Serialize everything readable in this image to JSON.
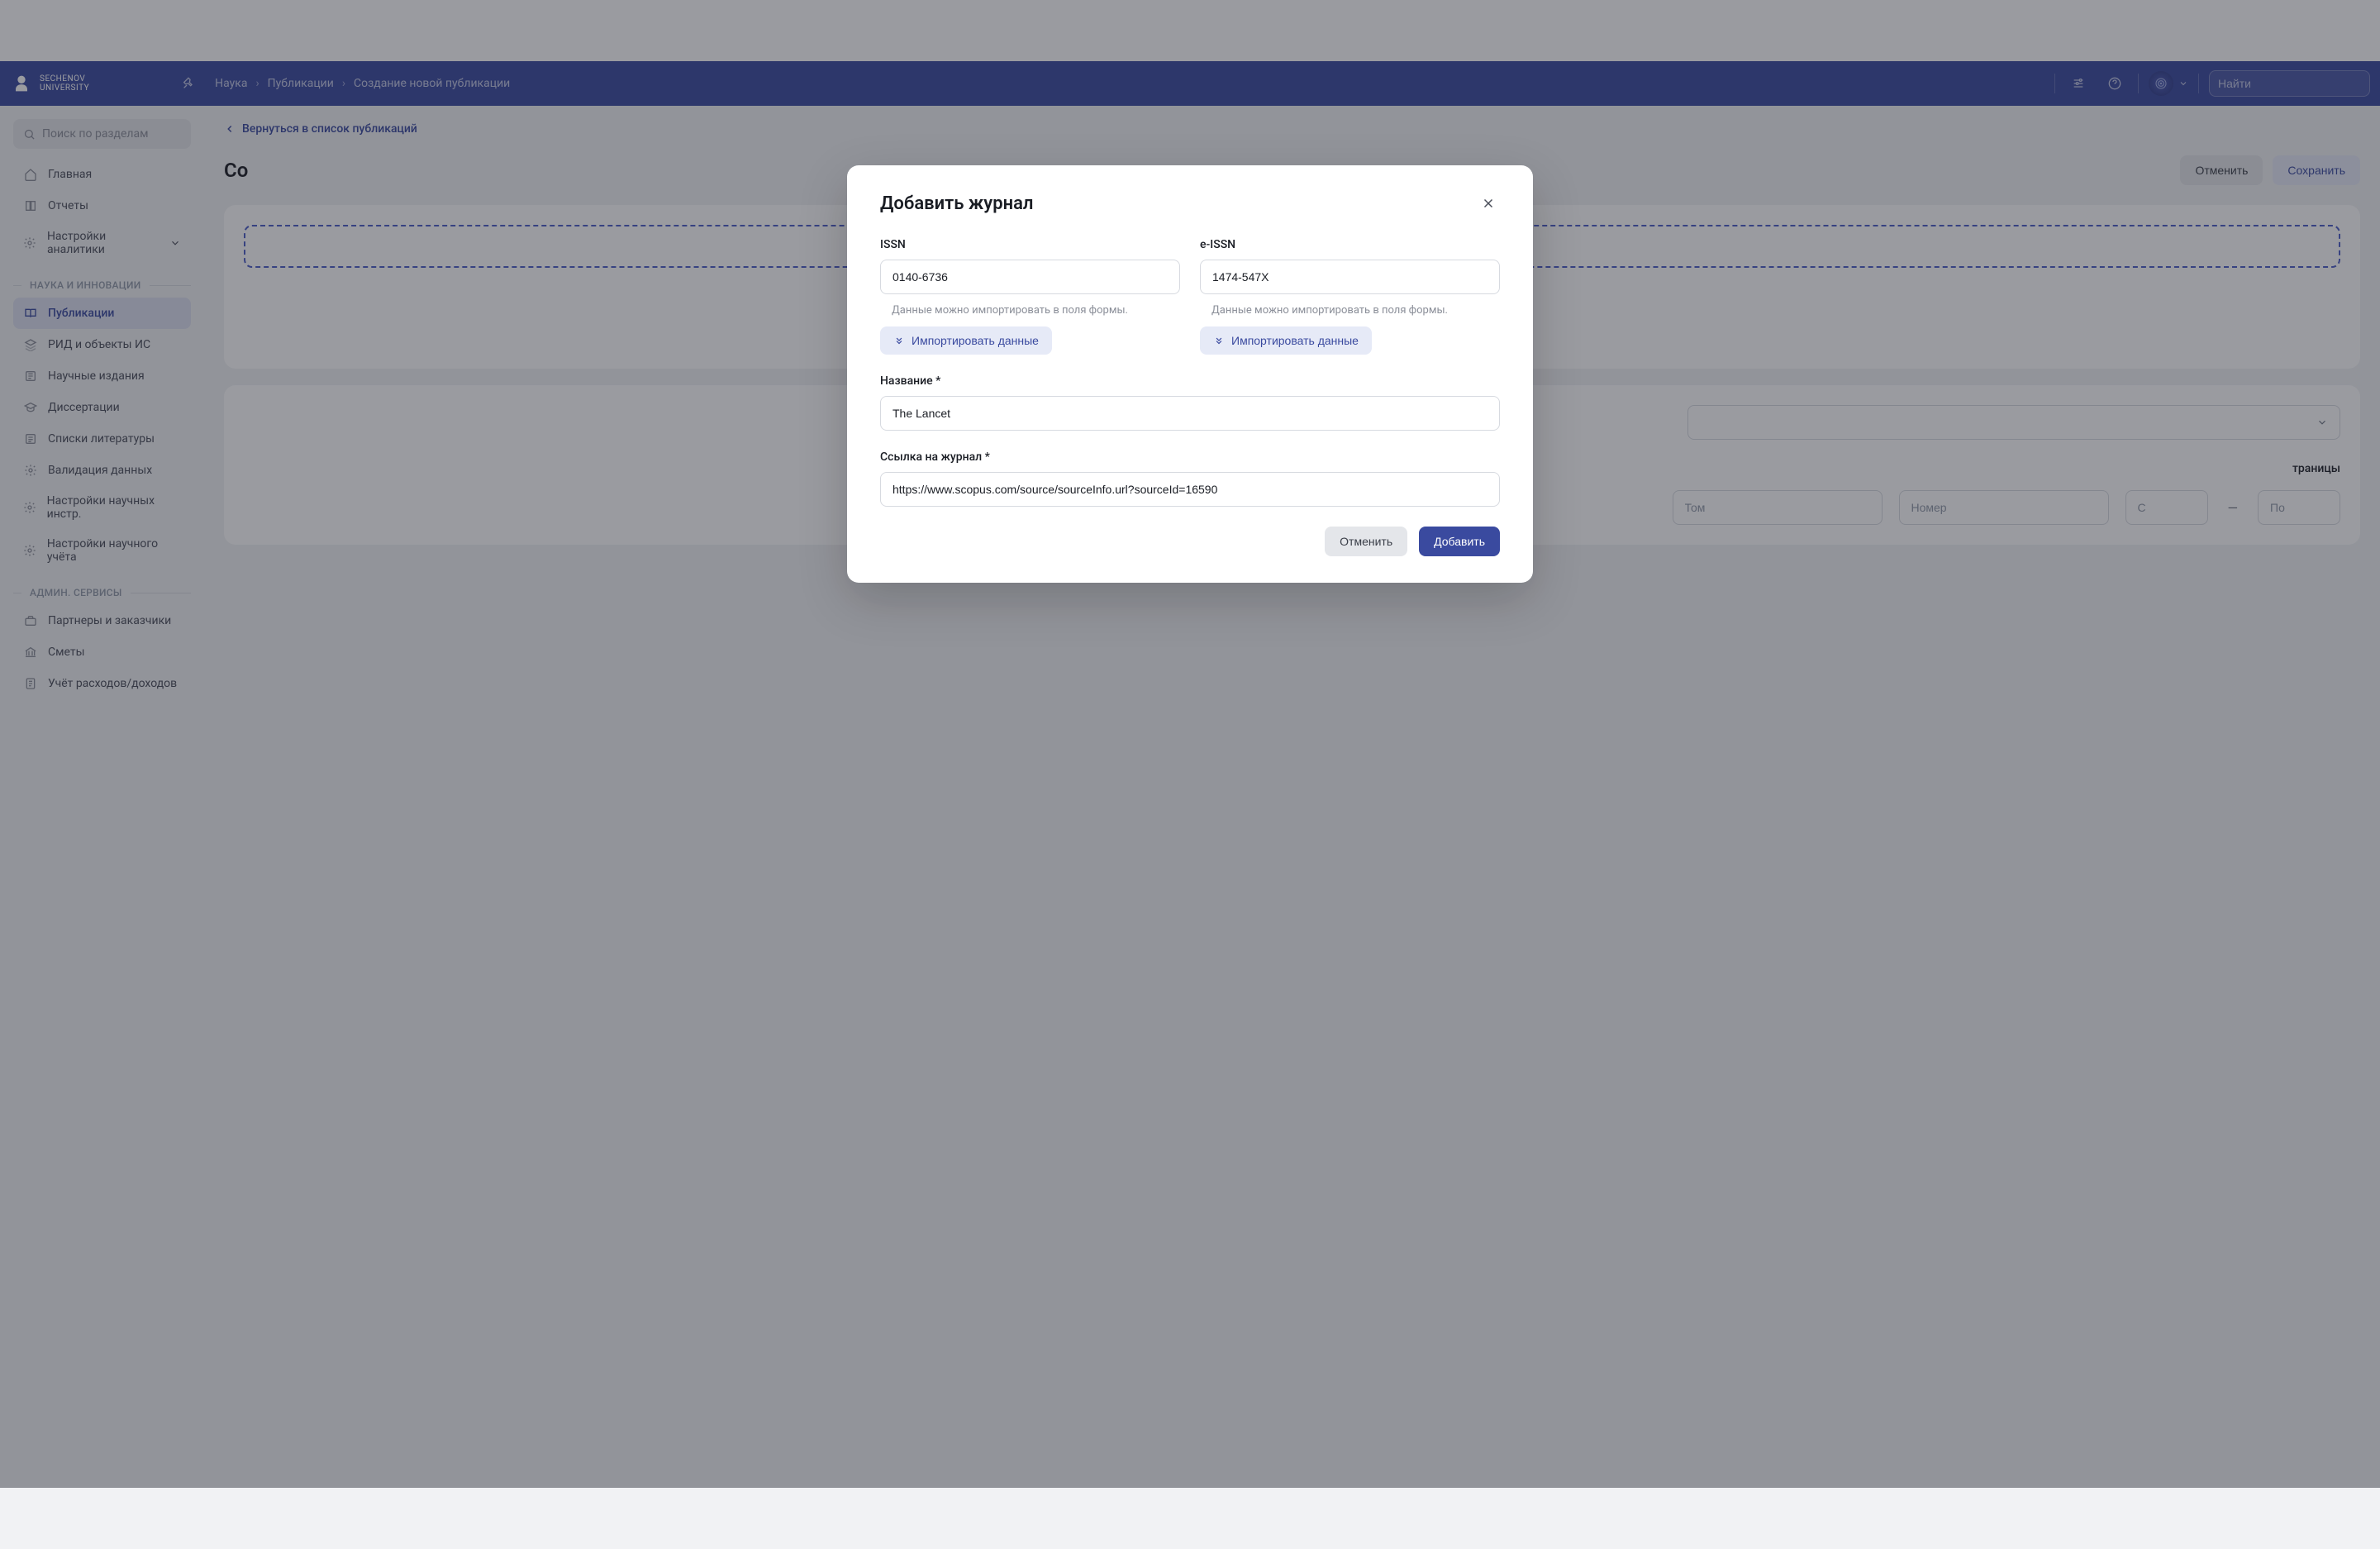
{
  "header": {
    "logo_line1": "Sechenov",
    "logo_line2": "University",
    "breadcrumb": [
      "Наука",
      "Публикации",
      "Создание новой публикации"
    ],
    "search_placeholder": "Найти"
  },
  "sidebar": {
    "search_placeholder": "Поиск по разделам",
    "items_top": [
      {
        "label": "Главная"
      },
      {
        "label": "Отчеты"
      },
      {
        "label": "Настройки аналитики",
        "expandable": true
      }
    ],
    "section1": "НАУКА И ИННОВАЦИИ",
    "items_science": [
      {
        "label": "Публикации",
        "active": true
      },
      {
        "label": "РИД и объекты ИС"
      },
      {
        "label": "Научные издания"
      },
      {
        "label": "Диссертации"
      },
      {
        "label": "Списки литературы"
      },
      {
        "label": "Валидация данных"
      },
      {
        "label": "Настройки научных инстр."
      },
      {
        "label": "Настройки научного учёта"
      }
    ],
    "section2": "АДМИН. СЕРВИСЫ",
    "items_admin": [
      {
        "label": "Партнеры и заказчики"
      },
      {
        "label": "Сметы"
      },
      {
        "label": "Учёт расходов/доходов"
      }
    ]
  },
  "page": {
    "backlink": "Вернуться в список публикаций",
    "title_partial": "Со",
    "cancel": "Отменить",
    "save": "Сохранить",
    "fields": {
      "pages_label": "траницы",
      "tom_placeholder": "Том",
      "number_placeholder": "Номер",
      "from_placeholder": "С",
      "to_placeholder": "По"
    }
  },
  "modal": {
    "title": "Добавить журнал",
    "issn_label": "ISSN",
    "issn_value": "0140-6736",
    "eissn_label": "e-ISSN",
    "eissn_value": "1474-547X",
    "hint": "Данные можно импортировать в поля формы.",
    "import_label": "Импортировать данные",
    "name_label": "Название *",
    "name_value": "The Lancet",
    "link_label": "Ссылка на журнал *",
    "link_value": "https://www.scopus.com/source/sourceInfo.url?sourceId=16590",
    "cancel": "Отменить",
    "add": "Добавить"
  }
}
